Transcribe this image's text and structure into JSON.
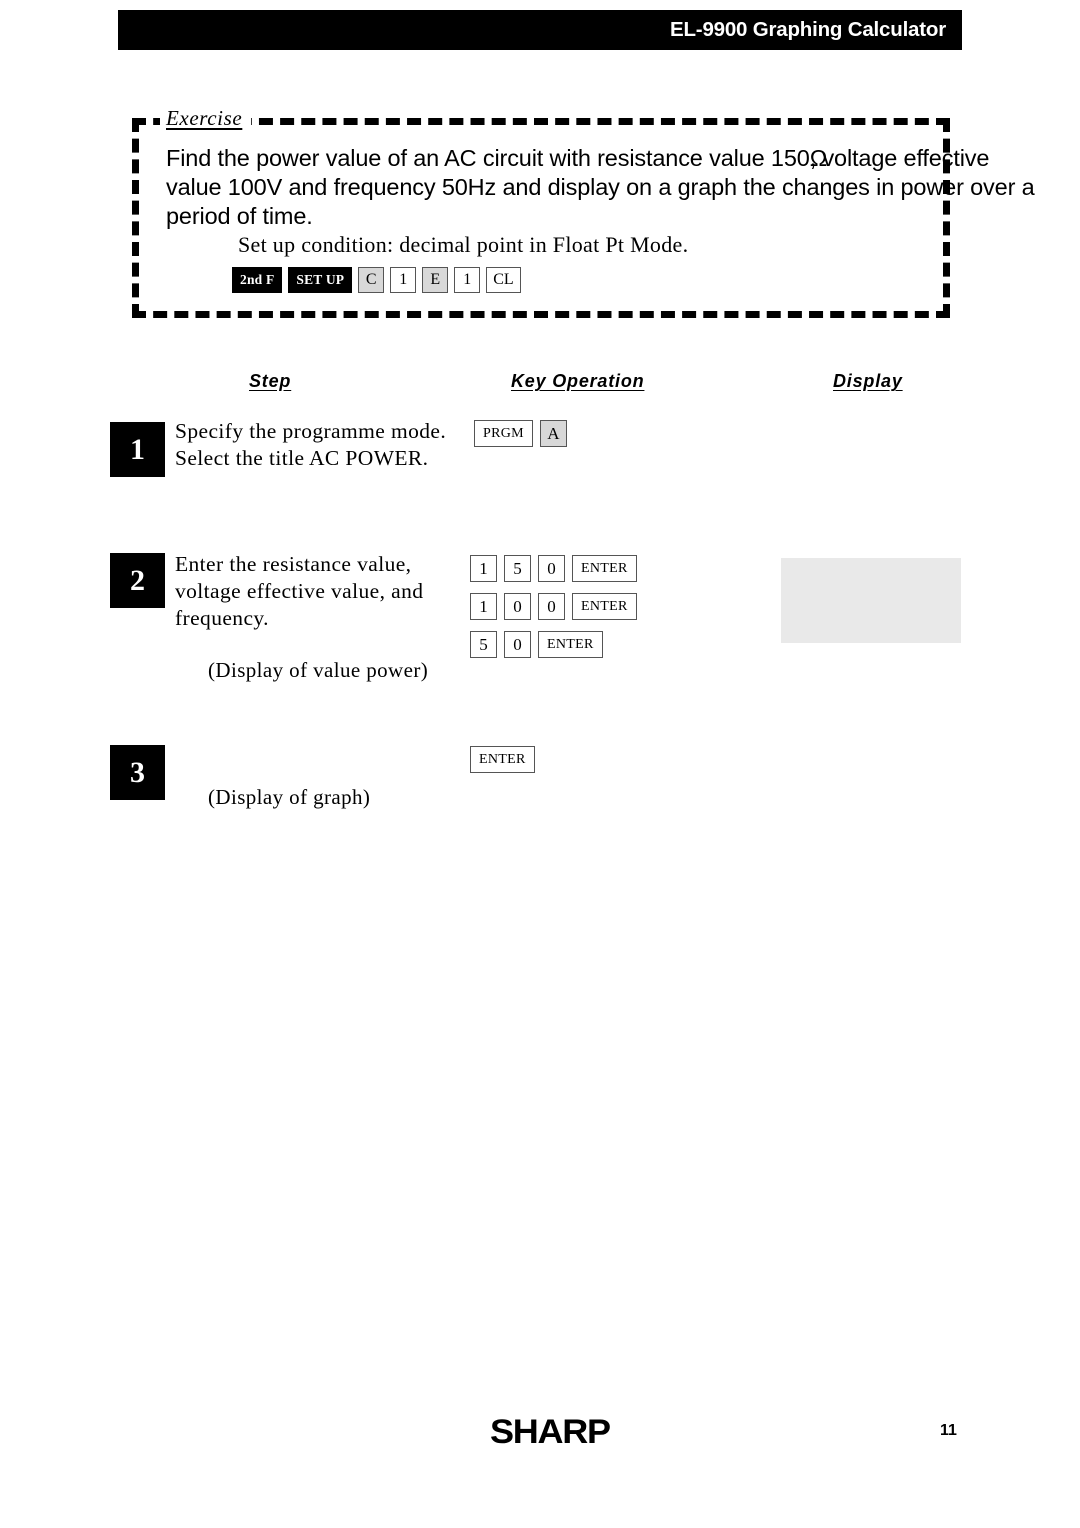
{
  "header": {
    "title": "EL-9900 Graphing Calculator"
  },
  "exercise": {
    "label": "Exercise",
    "prose_part1": "Find the power value of an AC circuit with resistance value 150",
    "prose_ohm": "Ω",
    "prose_part2": ", voltage effective value 100V and frequency 50Hz and display on a graph the changes in power over a period of time.",
    "setup_line": "Set up condition: decimal point in Float Pt Mode.",
    "setup_keys": [
      {
        "label": "2nd F",
        "style": "dark"
      },
      {
        "label": "SET UP",
        "style": "dark"
      },
      {
        "label": "C",
        "style": "gray"
      },
      {
        "label": "1",
        "style": "white"
      },
      {
        "label": "E",
        "style": "gray"
      },
      {
        "label": "1",
        "style": "white"
      },
      {
        "label": "CL",
        "style": "white"
      }
    ]
  },
  "columns": {
    "step": "Step",
    "key_operation": "Key Operation",
    "display": "Display"
  },
  "steps": [
    {
      "number": "1",
      "text_line1": "Specify the programme mode.",
      "text_line2": "Select the title AC POWER.",
      "keys": [
        {
          "label": "PRGM",
          "style": "white"
        },
        {
          "label": "A",
          "style": "gray"
        }
      ]
    },
    {
      "number": "2",
      "text_line1": "Enter the resistance value,",
      "text_line2": "voltage effective value, and",
      "text_line3": "frequency.",
      "note": "(Display of value power)",
      "key_rows": [
        [
          {
            "label": "1",
            "style": "white"
          },
          {
            "label": "5",
            "style": "white"
          },
          {
            "label": "0",
            "style": "white"
          },
          {
            "label": "ENTER",
            "style": "white"
          }
        ],
        [
          {
            "label": "1",
            "style": "white"
          },
          {
            "label": "0",
            "style": "white"
          },
          {
            "label": "0",
            "style": "white"
          },
          {
            "label": "ENTER",
            "style": "white"
          }
        ],
        [
          {
            "label": "5",
            "style": "white"
          },
          {
            "label": "0",
            "style": "white"
          },
          {
            "label": "ENTER",
            "style": "white"
          }
        ]
      ]
    },
    {
      "number": "3",
      "note": "(Display of graph)",
      "keys": [
        {
          "label": "ENTER",
          "style": "white"
        }
      ]
    }
  ],
  "footer": {
    "logo": "SHARP",
    "page_number": "11"
  },
  "colors": {
    "header_bar": "#000000",
    "header_text": "#ffffff",
    "ink": "#000000",
    "key_gray": "#d8d8d8",
    "display_placeholder": "#e9e9e9"
  }
}
